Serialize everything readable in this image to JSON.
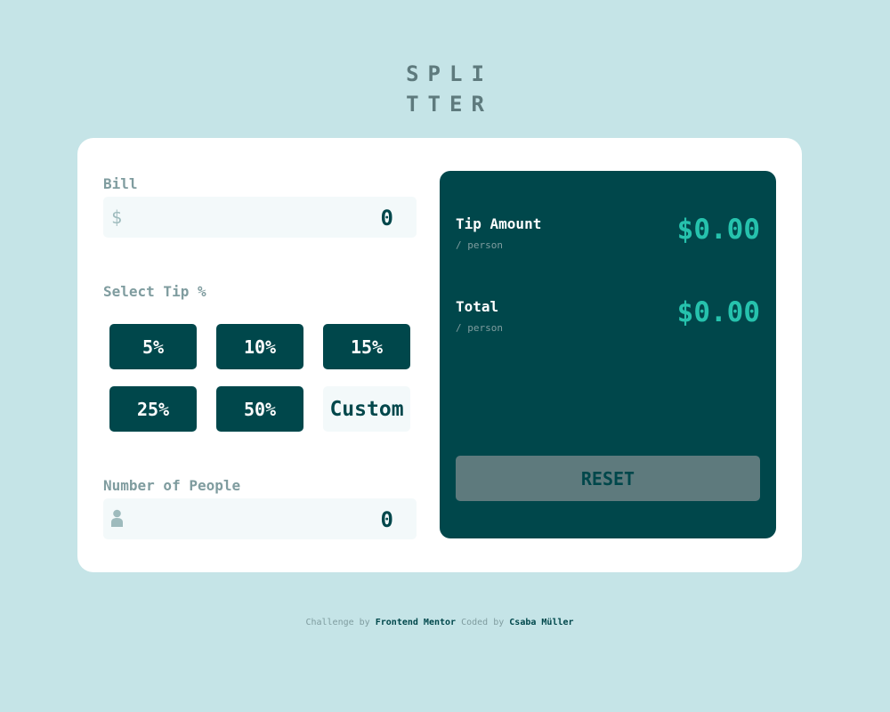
{
  "logo": {
    "line1": "SPLI",
    "line2": "TTER"
  },
  "bill": {
    "label": "Bill",
    "currency_symbol": "$",
    "value": "0"
  },
  "tip": {
    "label": "Select Tip %",
    "options": [
      "5%",
      "10%",
      "15%",
      "25%",
      "50%"
    ],
    "custom_label": "Custom"
  },
  "people": {
    "label": "Number of People",
    "value": "0",
    "icon": "person-icon"
  },
  "results": {
    "tip_amount": {
      "label": "Tip Amount",
      "sub": "/ person",
      "value": "$0.00"
    },
    "total": {
      "label": "Total",
      "sub": "/ person",
      "value": "$0.00"
    },
    "reset_label": "RESET"
  },
  "attribution": {
    "prefix": "Challenge by",
    "link1": "Frontend Mentor",
    "middle": "Coded by",
    "link2": "Csaba Müller"
  },
  "colors": {
    "background": "#c5e4e7",
    "dark_cyan": "#00474b",
    "accent": "#26c2ad",
    "grayish_cyan": "#5e7a7d",
    "light_field": "#f3f9fa"
  }
}
